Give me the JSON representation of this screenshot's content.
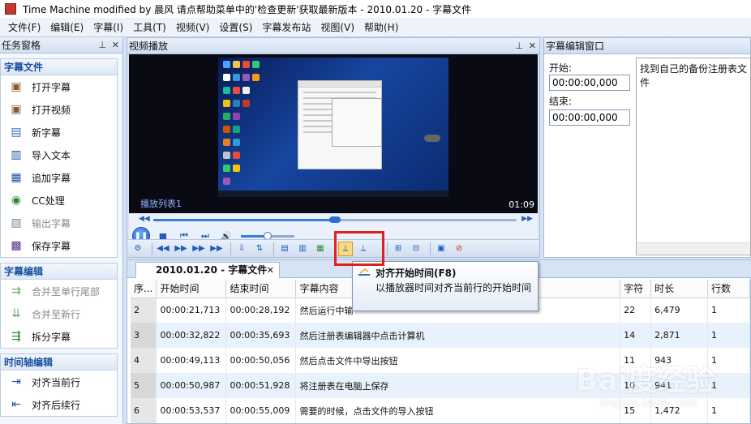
{
  "window": {
    "title": "Time Machine modified by 晨风 请点帮助菜单中的'检查更新'获取最新版本 - 2010.01.20 - 字幕文件"
  },
  "menu": [
    "文件(F)",
    "编辑(E)",
    "字幕(I)",
    "工具(T)",
    "视频(V)",
    "设置(S)",
    "字幕发布站",
    "视图(V)",
    "帮助(H)"
  ],
  "taskpane": {
    "title": "任务窗格",
    "groups": [
      {
        "header": "字幕文件",
        "items": [
          {
            "label": "打开字幕",
            "icon": "open-subtitle-icon",
            "enabled": true
          },
          {
            "label": "打开视频",
            "icon": "open-video-icon",
            "enabled": true
          },
          {
            "label": "新字幕",
            "icon": "new-subtitle-icon",
            "enabled": true
          },
          {
            "label": "导入文本",
            "icon": "import-text-icon",
            "enabled": true
          },
          {
            "label": "追加字幕",
            "icon": "append-subtitle-icon",
            "enabled": true
          },
          {
            "label": "CC处理",
            "icon": "cc-icon",
            "enabled": true
          },
          {
            "label": "输出字幕",
            "icon": "export-subtitle-icon",
            "enabled": false
          },
          {
            "label": "保存字幕",
            "icon": "save-icon",
            "enabled": true
          }
        ]
      },
      {
        "header": "字幕编辑",
        "items": [
          {
            "label": "合并至单行尾部",
            "icon": "merge-tail-icon",
            "enabled": false
          },
          {
            "label": "合并至新行",
            "icon": "merge-newline-icon",
            "enabled": false
          },
          {
            "label": "拆分字幕",
            "icon": "split-icon",
            "enabled": true
          }
        ]
      },
      {
        "header": "时间轴编辑",
        "items": [
          {
            "label": "对齐当前行",
            "icon": "align-current-icon",
            "enabled": true
          },
          {
            "label": "对齐后续行",
            "icon": "align-following-icon",
            "enabled": true
          }
        ]
      }
    ]
  },
  "video": {
    "title": "视频播放",
    "playlist_label": "播放列表1",
    "time": "01:09",
    "seek_progress": 0.5,
    "volume": 0.5
  },
  "editor": {
    "title": "字幕编辑窗口",
    "start_label": "开始:",
    "start_value": "00:00:00,000",
    "end_label": "结束:",
    "end_value": "00:00:00,000",
    "text": "找到自己的备份注册表文件"
  },
  "document": {
    "tab_label": "2010.01.20 - 字幕文件",
    "columns": [
      "序...",
      "开始时间",
      "结束时间",
      "字幕内容",
      "字符",
      "时长",
      "行数"
    ],
    "rows": [
      {
        "seq": "2",
        "start": "00:00:21,713",
        "end": "00:00:28,192",
        "text": "然后运行中输",
        "chars": "22",
        "duration": "6,479",
        "lines": "1"
      },
      {
        "seq": "3",
        "start": "00:00:32,822",
        "end": "00:00:35,693",
        "text": "然后注册表编辑器中点击计算机",
        "chars": "14",
        "duration": "2,871",
        "lines": "1"
      },
      {
        "seq": "4",
        "start": "00:00:49,113",
        "end": "00:00:50,056",
        "text": "然后点击文件中导出按钮",
        "chars": "11",
        "duration": "943",
        "lines": "1"
      },
      {
        "seq": "5",
        "start": "00:00:50,987",
        "end": "00:00:51,928",
        "text": "将注册表在电脑上保存",
        "chars": "10",
        "duration": "941",
        "lines": "1"
      },
      {
        "seq": "6",
        "start": "00:00:53,537",
        "end": "00:00:55,009",
        "text": "需要的时候，点击文件的导入按钮",
        "chars": "15",
        "duration": "1,472",
        "lines": "1"
      }
    ]
  },
  "tooltip": {
    "title": "对齐开始时间(F8)",
    "description": "以播放器时间对齐当前行的开始时间"
  },
  "watermark": {
    "text": "Bai度经验",
    "sub": "jingyan.baidu.com"
  },
  "colors": {
    "accent": "#1a4fa0",
    "highlight": "#e02020",
    "tooltip_border": "#7d96b8"
  }
}
